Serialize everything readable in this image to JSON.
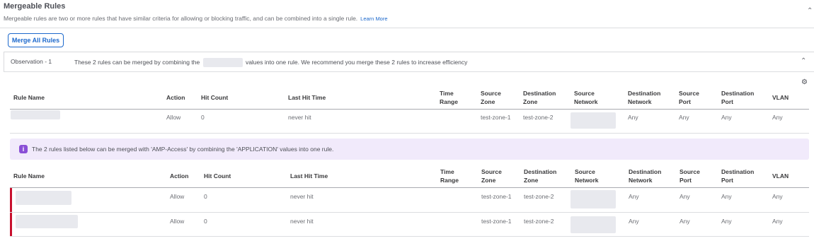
{
  "section": {
    "title": "Mergeable Rules",
    "description": "Mergeable rules are two or more rules that have similar criteria for allowing or blocking traffic, and can be combined into a single rule.",
    "learn_more": "Learn More",
    "merge_all_button": "Merge All Rules"
  },
  "observation": {
    "label": "Observation - 1",
    "text_before": "These 2 rules can be merged by combining the",
    "text_after": "values into one rule. We recommend you merge these 2 rules to increase efficiency"
  },
  "columns": {
    "rule_name": "Rule Name",
    "action": "Action",
    "hit_count": "Hit Count",
    "last_hit_time": "Last Hit Time",
    "time_range": [
      "Time",
      "Range"
    ],
    "source_zone": [
      "Source",
      "Zone"
    ],
    "destination_zone": [
      "Destination",
      "Zone"
    ],
    "source_network": [
      "Source",
      "Network"
    ],
    "destination_network": [
      "Destination",
      "Network"
    ],
    "source_port": [
      "Source",
      "Port"
    ],
    "destination_port": [
      "Destination",
      "Port"
    ],
    "vlan": "VLAN"
  },
  "primary_rule": {
    "action": "Allow",
    "hit_count": "0",
    "last_hit_time": "never hit",
    "source_zone": "test-zone-1",
    "destination_zone": "test-zone-2",
    "destination_network": "Any",
    "source_port": "Any",
    "destination_port": "Any",
    "vlan": "Any"
  },
  "banner": {
    "icon": "info-icon",
    "text": "The 2 rules listed below can be merged with 'AMP-Access' by combining the 'APPLICATION' values into one rule."
  },
  "merge_rules": [
    {
      "action": "Allow",
      "hit_count": "0",
      "last_hit_time": "never hit",
      "source_zone": "test-zone-1",
      "destination_zone": "test-zone-2",
      "destination_network": "Any",
      "source_port": "Any",
      "destination_port": "Any",
      "vlan": "Any"
    },
    {
      "action": "Allow",
      "hit_count": "0",
      "last_hit_time": "never hit",
      "source_zone": "test-zone-1",
      "destination_zone": "test-zone-2",
      "destination_network": "Any",
      "source_port": "Any",
      "destination_port": "Any",
      "vlan": "Any"
    }
  ],
  "colors": {
    "accent": "#1d69cc",
    "banner_bg": "#f1eafb",
    "banner_icon": "#8a4fd6",
    "row_marker": "#c8102e"
  }
}
